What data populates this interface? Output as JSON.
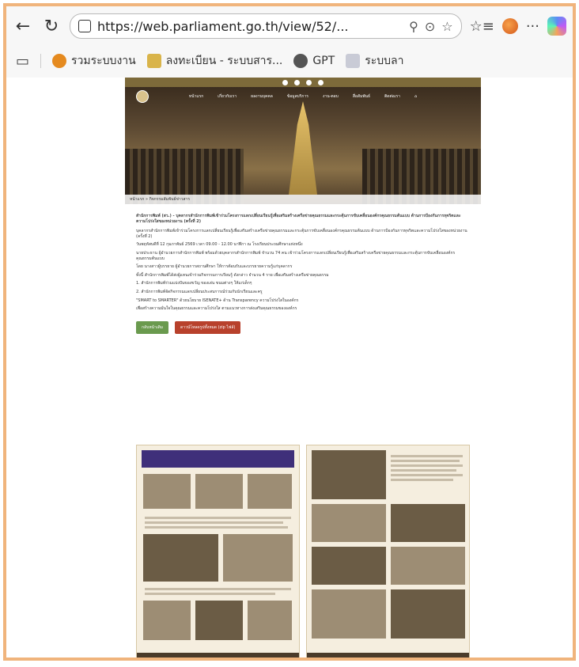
{
  "browser": {
    "url": "https://web.parliament.go.th/view/52/...",
    "bookmarks": [
      "รวมระบบงาน",
      "ลงทะเบียน - ระบบสาร...",
      "GPT",
      "ระบบลา"
    ]
  },
  "site": {
    "menu": [
      "หน้าแรก",
      "เกี่ยวกับเรา",
      "ผลงานบุคคล",
      "ข้อมูลบริการ",
      "งาน-ตอบ",
      "สื่อสัมพันธ์",
      "ติดต่อเรา"
    ],
    "breadcrumb": "หน้าแรก » กิจกรรมสัมพันธ์ข่าวสาร"
  },
  "article": {
    "title": "สำนักการพิมพ์ (สว.) - บุคลากรสำนักการพิมพ์เข้าร่วมโครงการแลกเปลี่ยนเรียนรู้เพื่อเสริมสร้างเครือข่ายคุณธรรมและกระตุ้นการขับเคลื่อนองค์กรคุณธรรมต้นแบบ ด้านการป้องกันการทุจริตและความโปร่งใสของหน่วยงาน (ครั้งที่ 2)",
    "paragraphs": [
      "บุคลากรสำนักการพิมพ์เข้าร่วมโครงการแลกเปลี่ยนเรียนรู้เพื่อเสริมสร้างเครือข่ายคุณธรรมและกระตุ้นการขับเคลื่อนองค์กรคุณธรรมต้นแบบ ด้านการป้องกันการทุจริตและความโปร่งใสของหน่วยงาน (ครั้งที่ 2)",
      "วันพฤหัสบดีที่ 12 กุมภาพันธ์ 2569 เวลา 09.00 - 12.00 นาฬิกา ณ โรงเรียนประถมศึกษาแห่งหนึ่ง",
      "นายประธาน ผู้อำนวยการสำนักการพิมพ์ พร้อมด้วยบุคลากรสำนักการพิมพ์ จำนวน 74 คน เข้าร่วมโครงการแลกเปลี่ยนเรียนรู้เพื่อเสริมสร้างเครือข่ายคุณธรรมและกระตุ้นการขับเคลื่อนองค์กรคุณธรรมต้นแบบ",
      "โดย นางสาวผู้บรรยาย ผู้อำนวยการสถานศึกษา ให้การต้อนรับและบรรยายความรู้แก่บุคลากร",
      "ทั้งนี้ สำนักการพิมพ์ได้ส่งผู้แทนเข้าร่วมกิจกรรมการเรียนรู้ ดังกล่าว จำนวน 4 ราย เพื่อเสริมสร้างเครือข่ายคุณธรรม",
      "1. สำนักการพิมพ์ร่วมแบ่งปันของขวัญ ของเล่น ขนมต่างๆ ให้แก่เด็กๆ",
      "2. สำนักการพิมพ์จัดกิจกรรมแลกเปลี่ยนประสบการณ์ร่วมกับนักเรียนและครู",
      "\"SMART to SMARTER\" ด้วยนโยบาย ISENATE+ ด้าน Transparency ความโปร่งใสในองค์กร",
      "เพื่อสร้างความมั่นใจในคุณธรรมและความโปร่งใส ตามแนวทางการส่งเสริมคุณธรรมขององค์กร"
    ],
    "back_button": "กลับหน้าเดิม",
    "download_button": "ดาวน์โหลดรูปทั้งหมด (zip ไฟล์)"
  }
}
